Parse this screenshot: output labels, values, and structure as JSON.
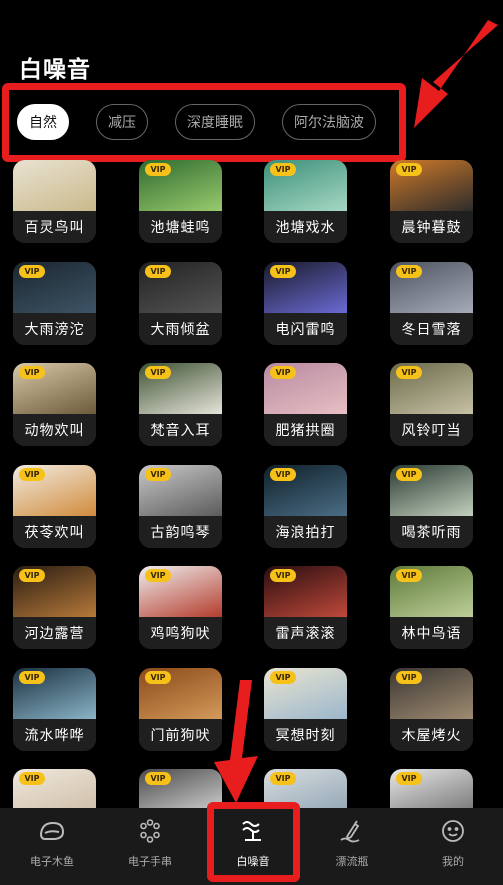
{
  "header": {
    "title": "白噪音"
  },
  "tabs": [
    {
      "label": "自然",
      "active": true
    },
    {
      "label": "减压",
      "active": false
    },
    {
      "label": "深度睡眠",
      "active": false
    },
    {
      "label": "阿尔法脑波",
      "active": false
    }
  ],
  "vip_label": "VIP",
  "sounds": [
    {
      "label": "百灵鸟叫",
      "vip": false
    },
    {
      "label": "池塘蛙鸣",
      "vip": true
    },
    {
      "label": "池塘戏水",
      "vip": true
    },
    {
      "label": "晨钟暮鼓",
      "vip": true
    },
    {
      "label": "大雨滂沱",
      "vip": true
    },
    {
      "label": "大雨倾盆",
      "vip": true
    },
    {
      "label": "电闪雷鸣",
      "vip": true
    },
    {
      "label": "冬日雪落",
      "vip": true
    },
    {
      "label": "动物欢叫",
      "vip": true
    },
    {
      "label": "梵音入耳",
      "vip": true
    },
    {
      "label": "肥猪拱圈",
      "vip": true
    },
    {
      "label": "风铃叮当",
      "vip": true
    },
    {
      "label": "茯苓欢叫",
      "vip": true
    },
    {
      "label": "古韵鸣琴",
      "vip": true
    },
    {
      "label": "海浪拍打",
      "vip": true
    },
    {
      "label": "喝茶听雨",
      "vip": true
    },
    {
      "label": "河边露营",
      "vip": true
    },
    {
      "label": "鸡鸣狗吠",
      "vip": true
    },
    {
      "label": "雷声滚滚",
      "vip": true
    },
    {
      "label": "林中鸟语",
      "vip": true
    },
    {
      "label": "流水哗哗",
      "vip": true
    },
    {
      "label": "门前狗吠",
      "vip": true
    },
    {
      "label": "冥想时刻",
      "vip": true
    },
    {
      "label": "木屋烤火",
      "vip": true
    },
    {
      "label": "",
      "vip": true
    },
    {
      "label": "",
      "vip": true
    },
    {
      "label": "",
      "vip": true
    },
    {
      "label": "",
      "vip": true
    }
  ],
  "bottom_nav": [
    {
      "label": "电子木鱼",
      "icon": "wooden-fish-icon",
      "active": false
    },
    {
      "label": "电子手串",
      "icon": "bead-bracelet-icon",
      "active": false
    },
    {
      "label": "白噪音",
      "icon": "white-noise-icon",
      "active": true
    },
    {
      "label": "漂流瓶",
      "icon": "drift-bottle-icon",
      "active": false
    },
    {
      "label": "我的",
      "icon": "profile-icon",
      "active": false
    }
  ],
  "colors": {
    "annotation": "#e81d1d",
    "vip_badge": "#f6c21a",
    "background": "#000000"
  }
}
